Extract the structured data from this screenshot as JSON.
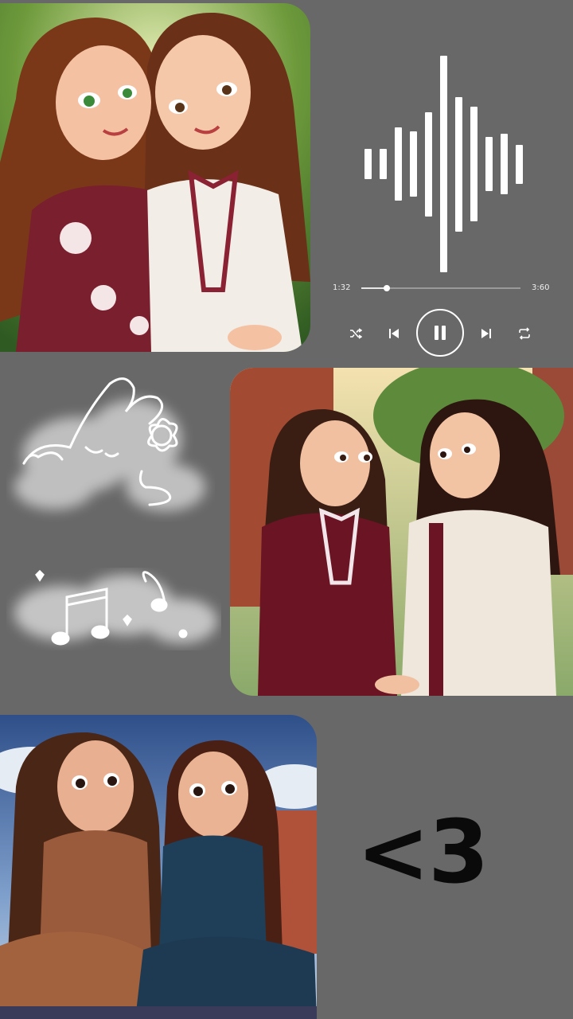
{
  "player": {
    "current_time": "1:32",
    "total_time": "3:60",
    "progress": 0.16,
    "waveform_levels": [
      0.14,
      0.14,
      0.34,
      0.3,
      0.48,
      1.0,
      0.62,
      0.53,
      0.25,
      0.28,
      0.18
    ],
    "icons": {
      "shuffle": "shuffle-icon",
      "previous": "skip-previous-icon",
      "play_pause": "pause-icon",
      "next": "skip-next-icon",
      "repeat": "repeat-icon"
    }
  },
  "caption": {
    "text": "<3"
  },
  "colors": {
    "background": "#686868",
    "maroon": "#7a1f2e",
    "ink": "#0a0a0a",
    "doodle": "#ffffff"
  }
}
